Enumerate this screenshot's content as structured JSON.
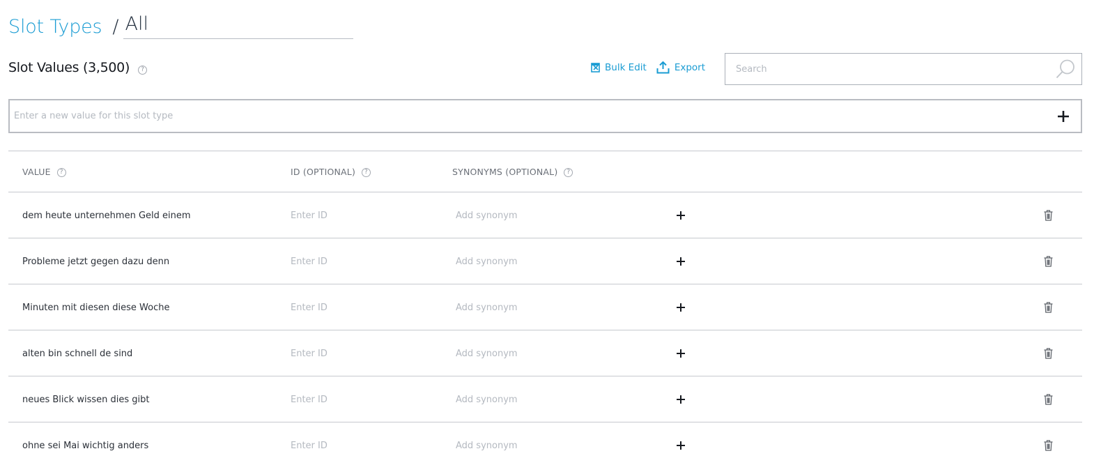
{
  "breadcrumb": {
    "parent": "Slot Types",
    "separator": "/",
    "current": "All"
  },
  "section": {
    "title": "Slot Values (3,500)",
    "help": "?"
  },
  "actions": {
    "bulk_edit": "Bulk Edit",
    "export": "Export"
  },
  "search": {
    "placeholder": "Search",
    "value": ""
  },
  "new_value": {
    "placeholder": "Enter a new value for this slot type",
    "value": ""
  },
  "table": {
    "columns": [
      {
        "label": "VALUE",
        "help": "?"
      },
      {
        "label": "ID (OPTIONAL)",
        "help": "?"
      },
      {
        "label": "SYNONYMS (OPTIONAL)",
        "help": "?"
      }
    ],
    "id_placeholder": "Enter ID",
    "synonym_placeholder": "Add synonym",
    "rows": [
      {
        "value": "dem heute unternehmen Geld einem",
        "id": "",
        "synonym": ""
      },
      {
        "value": "Probleme jetzt gegen dazu denn",
        "id": "",
        "synonym": ""
      },
      {
        "value": "Minuten mit diesen diese Woche",
        "id": "",
        "synonym": ""
      },
      {
        "value": "alten bin schnell de sind",
        "id": "",
        "synonym": ""
      },
      {
        "value": "neues Blick wissen dies gibt",
        "id": "",
        "synonym": ""
      },
      {
        "value": "ohne sei Mai wichtig anders",
        "id": "",
        "synonym": ""
      }
    ]
  },
  "colors": {
    "accent": "#1a9cd3",
    "text": "#232f3e",
    "muted": "#6b7078",
    "border": "#c6c9ce"
  },
  "icons": {
    "bulk_edit": "bulk-edit-icon",
    "export": "upload-icon",
    "search": "search-icon",
    "add": "plus-icon",
    "delete": "trash-icon",
    "help": "help-icon"
  }
}
